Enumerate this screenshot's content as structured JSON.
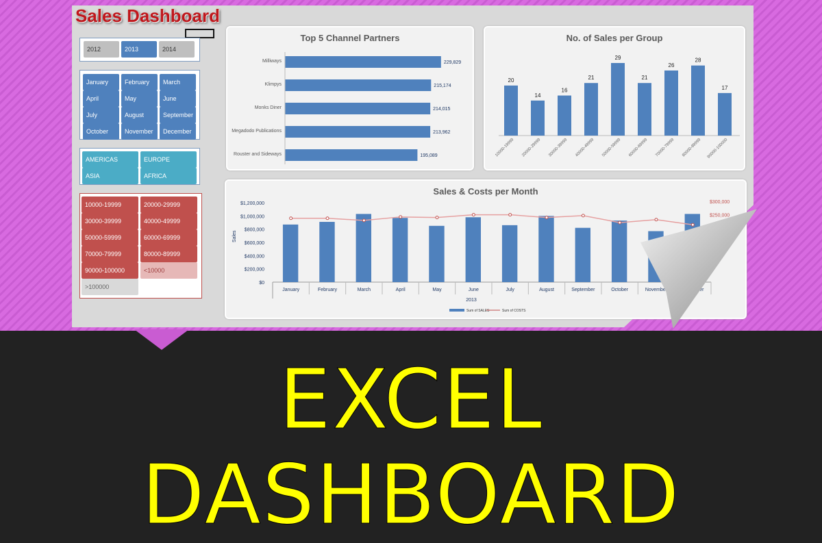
{
  "title": "Sales Dashboard",
  "years": [
    "2012",
    "2013",
    "2014"
  ],
  "selected_year": "2013",
  "months": [
    "January",
    "February",
    "March",
    "April",
    "May",
    "June",
    "July",
    "August",
    "September",
    "October",
    "November",
    "December"
  ],
  "regions": [
    "AMERICAS",
    "EUROPE",
    "ASIA",
    "AFRICA"
  ],
  "groups": [
    "10000-19999",
    "20000-29999",
    "30000-39999",
    "40000-49999",
    "50000-59999",
    "60000-69999",
    "70000-79999",
    "80000-89999",
    "90000-100000",
    "<10000",
    ">100000"
  ],
  "banner": "EXCEL DASHBOARD",
  "colors": {
    "bar": "#4f81bd",
    "costs": "#e6a0a0",
    "title": "#c0171c",
    "banner": "#ffff00"
  },
  "chart_data": [
    {
      "type": "bar",
      "title": "Top 5 Channel Partners",
      "orientation": "horizontal",
      "categories": [
        "Milliways",
        "Klimpys",
        "Monks Diner",
        "Megadodo Publications",
        "Rouster and Sideways"
      ],
      "values": [
        229829,
        215174,
        214015,
        213962,
        195089
      ],
      "labels": [
        "229,829",
        "215,174",
        "214,015",
        "213,962",
        "195,089"
      ]
    },
    {
      "type": "bar",
      "title": "No. of Sales per Group",
      "categories": [
        "10000-19999",
        "20000-29999",
        "30000-39999",
        "40000-49999",
        "50000-59999",
        "60000-69999",
        "70000-79999",
        "80000-89999",
        "90000-100000"
      ],
      "values": [
        20,
        14,
        16,
        21,
        29,
        21,
        26,
        28,
        17
      ]
    },
    {
      "type": "bar",
      "title": "Sales & Costs per Month",
      "xlabel": "2013",
      "ylabel": "Sales",
      "categories": [
        "January",
        "February",
        "March",
        "April",
        "May",
        "June",
        "July",
        "August",
        "September",
        "October",
        "November",
        "December"
      ],
      "ylim": [
        0,
        1200000
      ],
      "y_ticks": [
        "$0",
        "$200,000",
        "$400,000",
        "$600,000",
        "$800,000",
        "$1,000,000",
        "$1,200,000"
      ],
      "y2_ticks": [
        "$250,000",
        "$300,000"
      ],
      "y2lim": [
        0,
        300000
      ],
      "series": [
        {
          "name": "Sum of SALES",
          "type": "bar",
          "values": [
            870000,
            910000,
            1030000,
            970000,
            850000,
            980000,
            860000,
            1000000,
            820000,
            930000,
            770000,
            1030000
          ]
        },
        {
          "name": "Sum of COSTS",
          "type": "line",
          "axis": "secondary",
          "values": [
            237000,
            237000,
            229000,
            242000,
            240000,
            250000,
            250000,
            240000,
            247000,
            221000,
            232000,
            213000
          ]
        }
      ]
    }
  ]
}
